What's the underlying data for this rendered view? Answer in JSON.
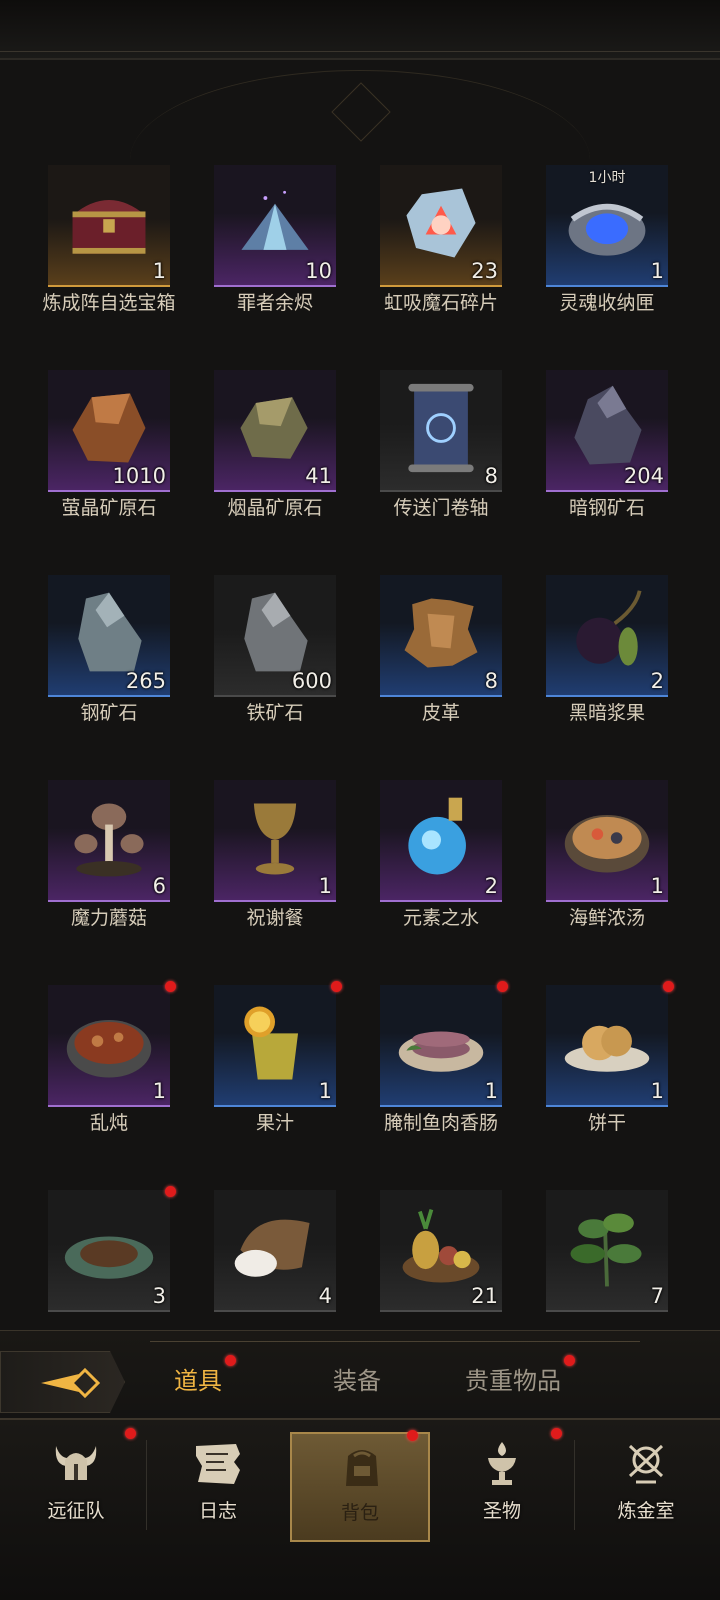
{
  "inventory": {
    "items": [
      {
        "name": "炼成阵自选宝箱",
        "count": "1",
        "rarity": "orange",
        "icon": "chest-icon",
        "timer": "",
        "dot": false
      },
      {
        "name": "罪者余烬",
        "count": "10",
        "rarity": "purple",
        "icon": "crystal-shard-icon",
        "timer": "",
        "dot": false
      },
      {
        "name": "虹吸魔石碎片",
        "count": "23",
        "rarity": "orange",
        "icon": "magic-stone-icon",
        "timer": "",
        "dot": false
      },
      {
        "name": "灵魂收纳匣",
        "count": "1",
        "rarity": "blue",
        "icon": "soul-box-icon",
        "timer": "1小时",
        "dot": false
      },
      {
        "name": "萤晶矿原石",
        "count": "1010",
        "rarity": "purple",
        "icon": "amber-ore-icon",
        "timer": "",
        "dot": false
      },
      {
        "name": "烟晶矿原石",
        "count": "41",
        "rarity": "purple",
        "icon": "smoky-ore-icon",
        "timer": "",
        "dot": false
      },
      {
        "name": "传送门卷轴",
        "count": "8",
        "rarity": "gray",
        "icon": "scroll-icon",
        "timer": "",
        "dot": false
      },
      {
        "name": "暗钢矿石",
        "count": "204",
        "rarity": "purple",
        "icon": "dark-steel-ore-icon",
        "timer": "",
        "dot": false
      },
      {
        "name": "钢矿石",
        "count": "265",
        "rarity": "blue",
        "icon": "steel-ore-icon",
        "timer": "",
        "dot": false
      },
      {
        "name": "铁矿石",
        "count": "600",
        "rarity": "gray",
        "icon": "iron-ore-icon",
        "timer": "",
        "dot": false
      },
      {
        "name": "皮革",
        "count": "8",
        "rarity": "blue",
        "icon": "leather-icon",
        "timer": "",
        "dot": false
      },
      {
        "name": "黑暗浆果",
        "count": "2",
        "rarity": "blue",
        "icon": "dark-berry-icon",
        "timer": "",
        "dot": false
      },
      {
        "name": "魔力蘑菇",
        "count": "6",
        "rarity": "purple",
        "icon": "mushroom-icon",
        "timer": "",
        "dot": false
      },
      {
        "name": "祝谢餐",
        "count": "1",
        "rarity": "purple",
        "icon": "goblet-icon",
        "timer": "",
        "dot": false
      },
      {
        "name": "元素之水",
        "count": "2",
        "rarity": "purple",
        "icon": "potion-icon",
        "timer": "",
        "dot": false
      },
      {
        "name": "海鲜浓汤",
        "count": "1",
        "rarity": "purple",
        "icon": "seafood-soup-icon",
        "timer": "",
        "dot": false
      },
      {
        "name": "乱炖",
        "count": "1",
        "rarity": "purple",
        "icon": "stew-icon",
        "timer": "",
        "dot": true
      },
      {
        "name": "果汁",
        "count": "1",
        "rarity": "blue",
        "icon": "juice-icon",
        "timer": "",
        "dot": true
      },
      {
        "name": "腌制鱼肉香肠",
        "count": "1",
        "rarity": "blue",
        "icon": "sausage-icon",
        "timer": "",
        "dot": true
      },
      {
        "name": "饼干",
        "count": "1",
        "rarity": "blue",
        "icon": "biscuit-icon",
        "timer": "",
        "dot": true
      },
      {
        "name": "",
        "count": "3",
        "rarity": "gray",
        "icon": "meat-plate-icon",
        "timer": "",
        "dot": true
      },
      {
        "name": "",
        "count": "4",
        "rarity": "gray",
        "icon": "rice-sack-icon",
        "timer": "",
        "dot": false
      },
      {
        "name": "",
        "count": "21",
        "rarity": "gray",
        "icon": "fruit-basket-icon",
        "timer": "",
        "dot": false
      },
      {
        "name": "",
        "count": "7",
        "rarity": "gray",
        "icon": "herb-icon",
        "timer": "",
        "dot": false
      }
    ]
  },
  "tabs": {
    "daoju": "道具",
    "zhuangbei": "装备",
    "guizhong": "贵重物品"
  },
  "nav": {
    "expedition": "远征队",
    "journal": "日志",
    "backpack": "背包",
    "relic": "圣物",
    "alchemy": "炼金室"
  },
  "colors": {
    "accent": "#f0b543",
    "badge": "#e01b1b"
  }
}
